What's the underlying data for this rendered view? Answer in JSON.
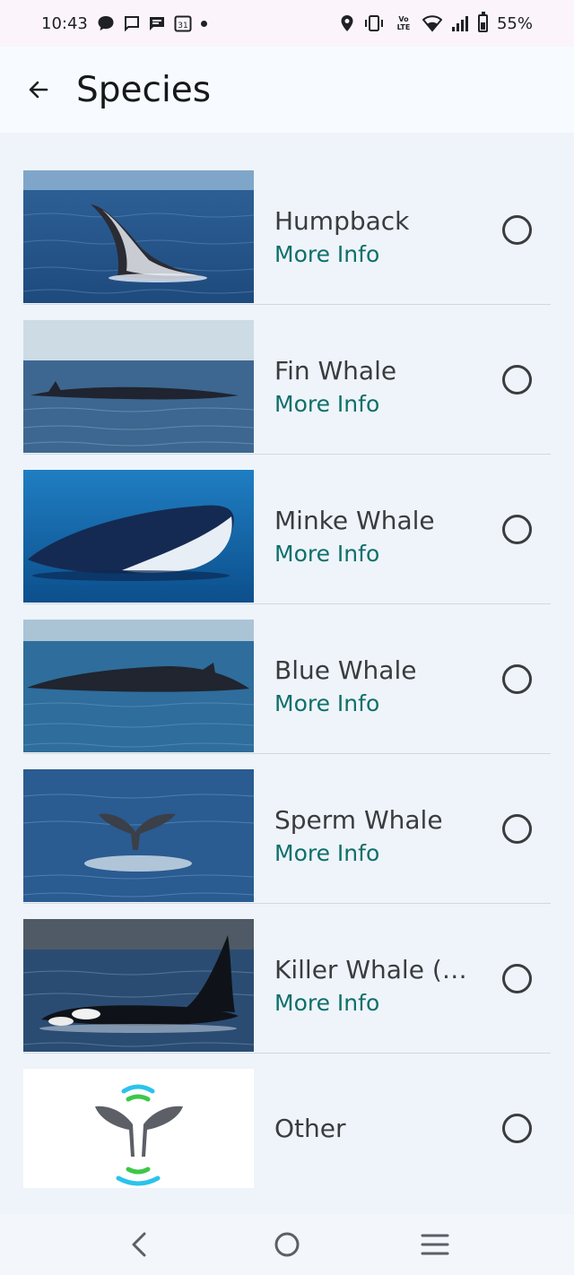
{
  "status_bar": {
    "time": "10:43",
    "battery_text": "55%",
    "calendar_day": "31",
    "left_icons": [
      "chat-bubble-icon",
      "message-icon",
      "message-filled-icon",
      "calendar-icon",
      "dot-icon"
    ],
    "right_icons": [
      "location-icon",
      "vibrate-icon",
      "volte-icon",
      "wifi-icon",
      "signal-icon",
      "battery-icon"
    ],
    "volte_label": "VoLTE"
  },
  "app_bar": {
    "title": "Species",
    "back_icon": "arrow-left-icon"
  },
  "species": [
    {
      "name": "Humpback",
      "link": "More Info",
      "image": "humpback-whale-photo"
    },
    {
      "name": "Fin Whale",
      "link": "More Info",
      "image": "fin-whale-photo"
    },
    {
      "name": "Minke Whale",
      "link": "More Info",
      "image": "minke-whale-photo"
    },
    {
      "name": "Blue Whale",
      "link": "More Info",
      "image": "blue-whale-photo"
    },
    {
      "name": "Sperm Whale",
      "link": "More Info",
      "image": "sperm-whale-photo"
    },
    {
      "name": "Killer Whale (Orca)",
      "link": "More Info",
      "image": "killer-whale-photo"
    },
    {
      "name": "Other",
      "link": "",
      "image": "whale-tail-logo"
    }
  ],
  "nav_bar": {
    "back": "nav-back-icon",
    "home": "nav-home-icon",
    "recents": "nav-menu-icon"
  },
  "colors": {
    "link": "#0f6f6a",
    "background": "#eef4fa",
    "app_bar": "#f7fbff",
    "status_bar": "#fbf5fb"
  }
}
